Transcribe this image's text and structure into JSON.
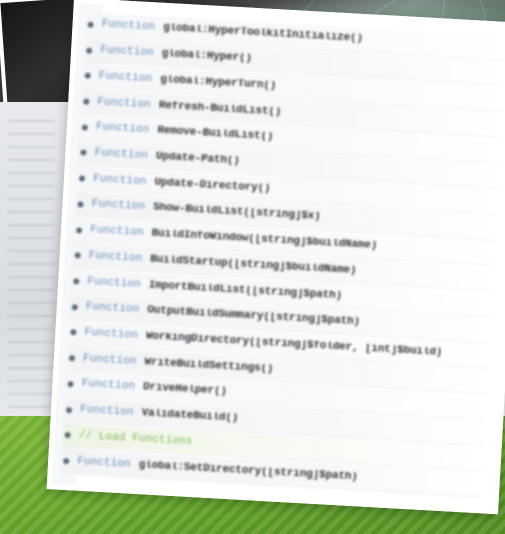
{
  "editor": {
    "lines": [
      {
        "keyword": "Function",
        "text": "global:HyperToolkitInitialize()"
      },
      {
        "keyword": "Function",
        "text": "global:Hyper()"
      },
      {
        "keyword": "Function",
        "text": "global:HyperTurn()"
      },
      {
        "keyword": "Function",
        "text": "Refresh-BuildList()"
      },
      {
        "keyword": "Function",
        "text": "Remove-BuildList()"
      },
      {
        "keyword": "Function",
        "text": "Update-Path()"
      },
      {
        "keyword": "Function",
        "text": "Update-Directory()"
      },
      {
        "keyword": "Function",
        "text": "Show-BuildList([string]$x)"
      },
      {
        "keyword": "Function",
        "text": "BuildInfoWindow([string]$buildName)"
      },
      {
        "keyword": "Function",
        "text": "BuildStartup([string]$buildName)"
      },
      {
        "keyword": "Function",
        "text": "ImportBuildList([string]$path)"
      },
      {
        "keyword": "Function",
        "text": "OutputBuildSummary([string]$path)"
      },
      {
        "keyword": "Function",
        "text": "WorkingDirectory([string]$folder, [int]$build)"
      },
      {
        "keyword": "Function",
        "text": "WriteBuildSettings()"
      },
      {
        "keyword": "Function",
        "text": "DriveHelper()"
      },
      {
        "keyword": "Function",
        "text": "ValidateBuild()"
      },
      {
        "keyword": "// Load Functions",
        "text": ""
      },
      {
        "keyword": "Function",
        "text": "global:SetDirectory([string]$path)"
      }
    ]
  }
}
